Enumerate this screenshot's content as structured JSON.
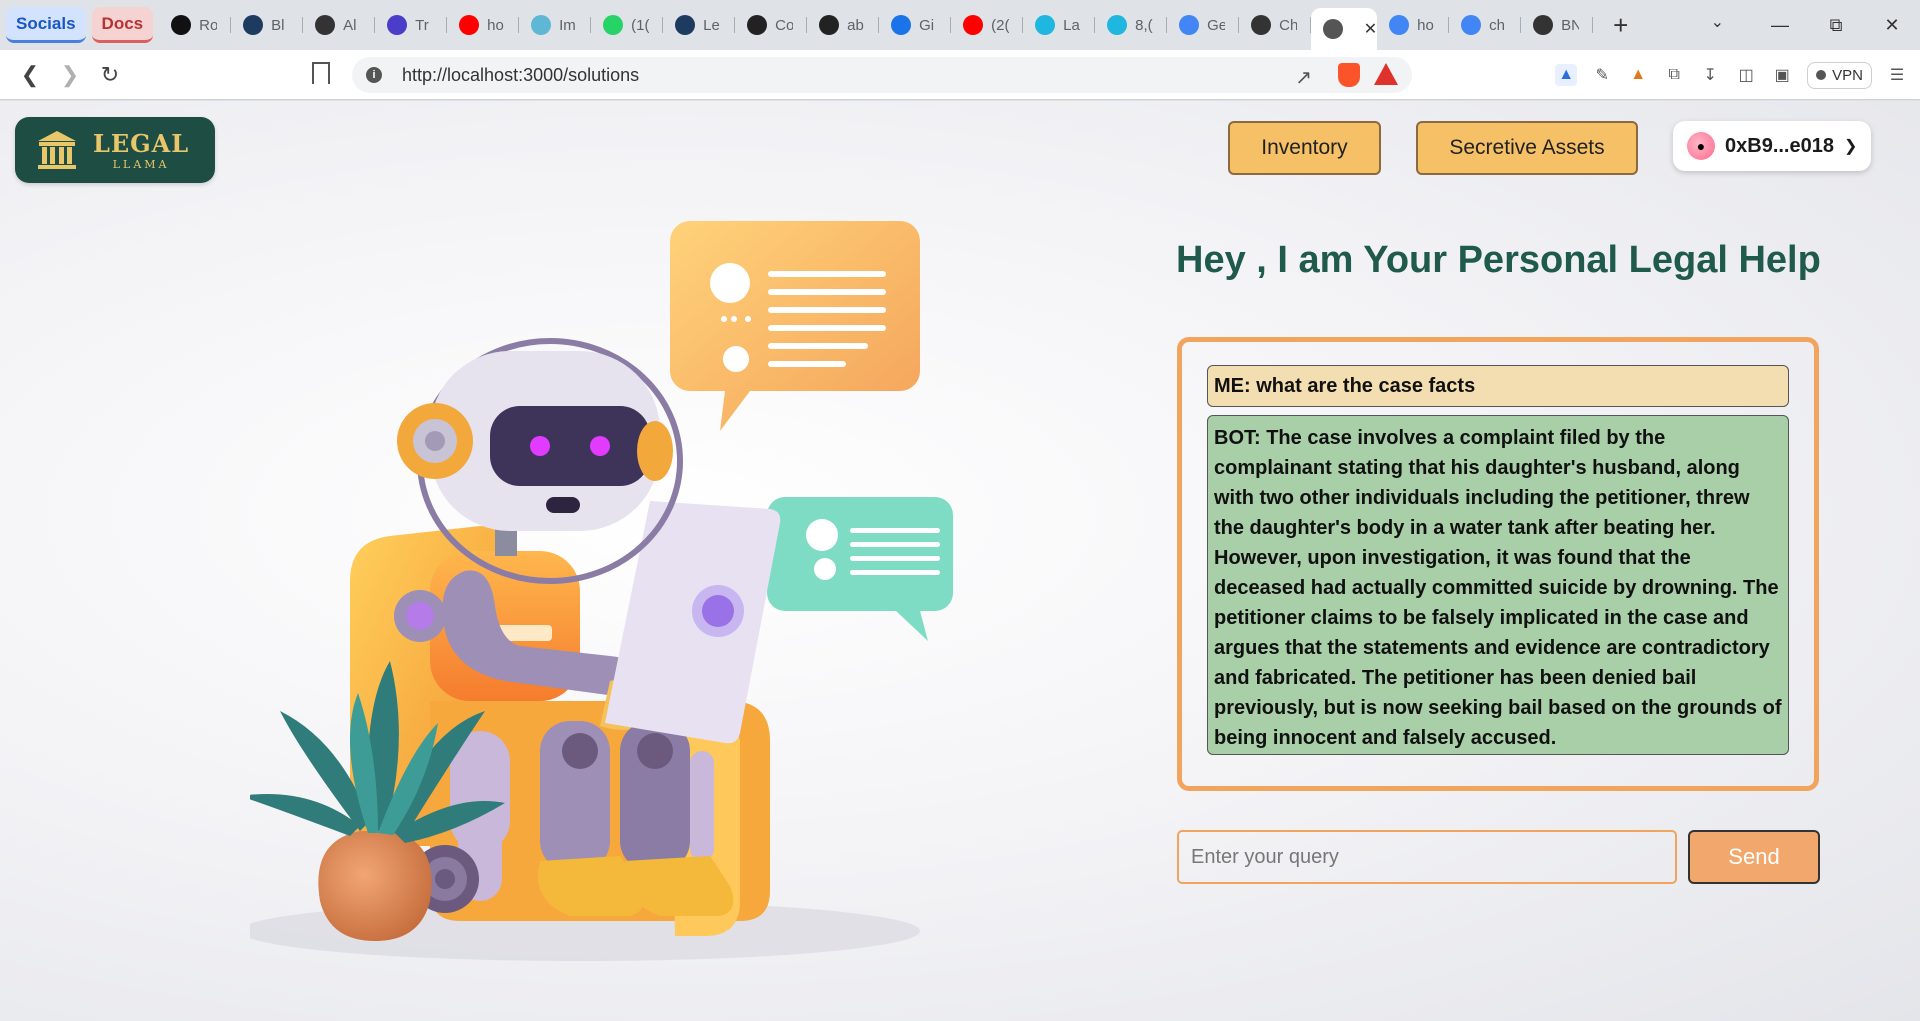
{
  "browser": {
    "tab_groups": [
      "Socials",
      "Docs"
    ],
    "tabs": [
      {
        "icon": "nextjs-icon",
        "text": "Ro",
        "color": "#111111"
      },
      {
        "icon": "devto-icon",
        "text": "Bl",
        "color": "#1d3a5f"
      },
      {
        "icon": "openai-icon",
        "text": "Al",
        "color": "#333333"
      },
      {
        "icon": "app-icon",
        "text": "Tr",
        "color": "#4b3cc9"
      },
      {
        "icon": "youtube-icon",
        "text": "ho",
        "color": "#ff0000"
      },
      {
        "icon": "react-icon",
        "text": "Im",
        "color": "#5fb7d6"
      },
      {
        "icon": "whatsapp-icon",
        "text": "(1(",
        "color": "#25d366"
      },
      {
        "icon": "devto-icon",
        "text": "Le",
        "color": "#1d3a5f"
      },
      {
        "icon": "github-icon",
        "text": "Co",
        "color": "#222222"
      },
      {
        "icon": "github-icon",
        "text": "ab",
        "color": "#222222"
      },
      {
        "icon": "google-ai-icon",
        "text": "Gi",
        "color": "#1a73e8"
      },
      {
        "icon": "youtube-icon",
        "text": "(2(",
        "color": "#ff0000"
      },
      {
        "icon": "search-bot-icon",
        "text": "La",
        "color": "#1fb6e0"
      },
      {
        "icon": "search-bot-icon",
        "text": "8,(",
        "color": "#1fb6e0"
      },
      {
        "icon": "gemini-icon",
        "text": "Ge",
        "color": "#4285f4"
      },
      {
        "icon": "openai-icon",
        "text": "Ch",
        "color": "#333333"
      },
      {
        "icon": "globe-icon",
        "text": "",
        "color": "#555555",
        "active": true
      },
      {
        "icon": "google-icon",
        "text": "ho",
        "color": "#4285f4"
      },
      {
        "icon": "google-icon",
        "text": "ch",
        "color": "#4285f4"
      },
      {
        "icon": "cat-icon",
        "text": "BN",
        "color": "#333333"
      }
    ],
    "url": "http://localhost:3000/solutions",
    "vpn_label": "VPN"
  },
  "header": {
    "logo_title": "LEGAL",
    "logo_subtitle": "LLAMA",
    "inventory_label": "Inventory",
    "secretive_assets_label": "Secretive Assets",
    "wallet_address": "0xB9...e018"
  },
  "main": {
    "headline": "Hey , I am Your Personal Legal Help",
    "messages": [
      {
        "role": "me",
        "text": "ME: what are the case facts"
      },
      {
        "role": "bot",
        "text": "BOT: The case involves a complaint filed by the complainant stating that his daughter's husband, along with two other individuals including the petitioner, threw the daughter's body in a water tank after beating her. However, upon investigation, it was found that the deceased had actually committed suicide by drowning. The petitioner claims to be falsely implicated in the case and argues that the statements and evidence are contradictory and fabricated. The petitioner has been denied bail previously, but is now seeking bail based on the grounds of being innocent and falsely accused."
      }
    ],
    "query_placeholder": "Enter your query",
    "send_label": "Send"
  },
  "colors": {
    "accent_orange": "#f0a45e",
    "button_yellow": "#f6c067",
    "brand_green": "#1f5a4d",
    "bot_bubble": "#a9cfa8",
    "me_bubble": "#f3deb1"
  }
}
